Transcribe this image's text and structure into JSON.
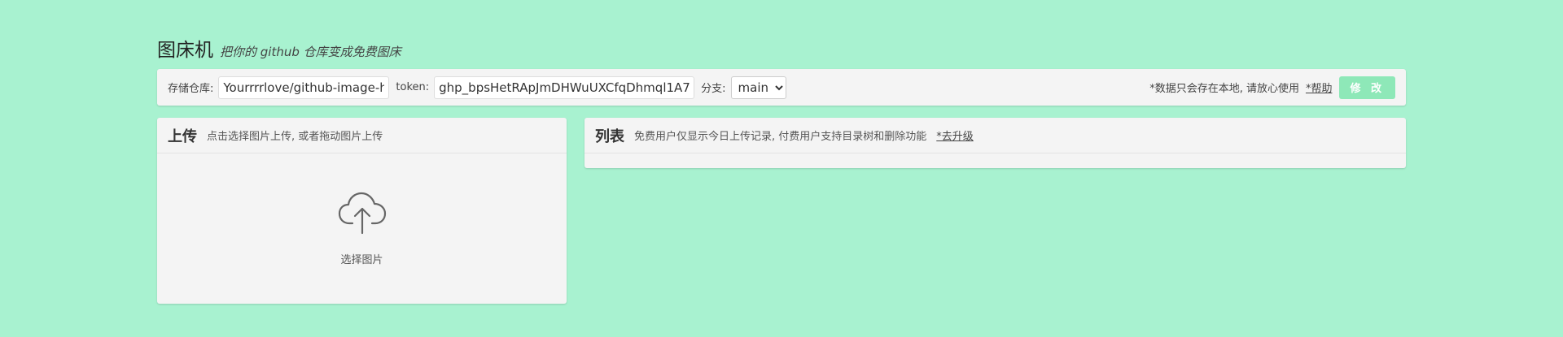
{
  "header": {
    "title": "图床机",
    "subtitle": "把你的 github 仓库变成免费图床"
  },
  "config": {
    "repo_label": "存储仓库:",
    "repo_value": "Yourrrrlove/github-image-hosting",
    "token_label": "token:",
    "token_value": "ghp_bpsHetRApJmDHWuUXCfqDhmql1A7",
    "branch_label": "分支:",
    "branch_value": "main",
    "notice": "*数据只会存在本地, 请放心使用",
    "help_link": "*帮助",
    "edit_button": "修 改"
  },
  "upload": {
    "title": "上传",
    "description": "点击选择图片上传, 或者拖动图片上传",
    "select_label": "选择图片",
    "icon": "cloud-upload-icon"
  },
  "list": {
    "title": "列表",
    "description": "免费用户仅显示今日上传记录, 付费用户支持目录树和删除功能",
    "upgrade_link": "*去升级"
  },
  "colors": {
    "background": "#a8f2d0",
    "panel": "#f4f4f4",
    "edit_button": "#8ee8b8"
  }
}
